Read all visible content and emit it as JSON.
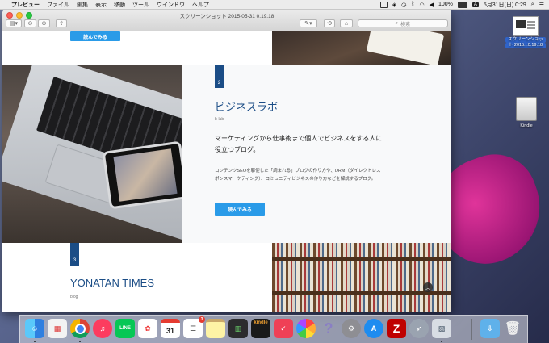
{
  "menubar": {
    "app_name": "プレビュー",
    "items": [
      "ファイル",
      "編集",
      "表示",
      "移動",
      "ツール",
      "ウインドウ",
      "ヘルプ"
    ],
    "battery": "100%",
    "ime": "A",
    "datetime": "5月31日(日) 0:29"
  },
  "window": {
    "title": "スクリーンショット 2015-05-31 0.19.18",
    "search_placeholder": "検索"
  },
  "page": {
    "section1": {
      "button_label": "読んでみる"
    },
    "section2": {
      "number": "2",
      "title": "ビジネスラボ",
      "subtitle": "b-lab",
      "lead": "マーケティングから仕事術まで個人でビジネスをする人に役立つブログ。",
      "description": "コンテンツSEOを駆使した「読まれる」ブログの作り方や、DRM（ダイレクトレスポンスマーケティング）、コミュニティビジネスの作り方などを解説するブログ。",
      "button_label": "読んでみる"
    },
    "section3": {
      "number": "3",
      "title": "YONATAN TIMES",
      "subtitle": "blog"
    }
  },
  "desktop": {
    "file_label_line1": "スクリーンショッ",
    "file_label_line2": "ト 2015...0.19.18",
    "drive_label": "Kindle"
  },
  "dock": {
    "calendar_day": "31",
    "reminders_badge": "3",
    "kindle_label": "kindle"
  }
}
